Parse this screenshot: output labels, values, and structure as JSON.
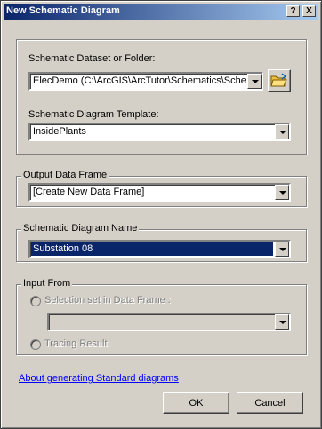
{
  "window": {
    "title": "New Schematic Diagram",
    "help_button": "?",
    "close_button": "X"
  },
  "dataset": {
    "label": "Schematic Dataset or Folder:",
    "value": "ElecDemo (C:\\ArcGIS\\ArcTutor\\Schematics\\Schema"
  },
  "template": {
    "label": "Schematic Diagram Template:",
    "value": "InsidePlants"
  },
  "output_frame": {
    "legend": "Output Data Frame",
    "value": "[Create New Data Frame]"
  },
  "diagram_name": {
    "legend": "Schematic Diagram Name",
    "value": "Substation 08"
  },
  "input_from": {
    "legend": "Input From",
    "selection_option": "Selection set in Data Frame :",
    "selection_value": "",
    "tracing_option": "Tracing Result"
  },
  "footer": {
    "help_link": "About generating Standard diagrams",
    "ok_label": "OK",
    "cancel_label": "Cancel"
  },
  "icons": {
    "browse": "open-folder-icon",
    "dropdown": "chevron-down-icon"
  }
}
